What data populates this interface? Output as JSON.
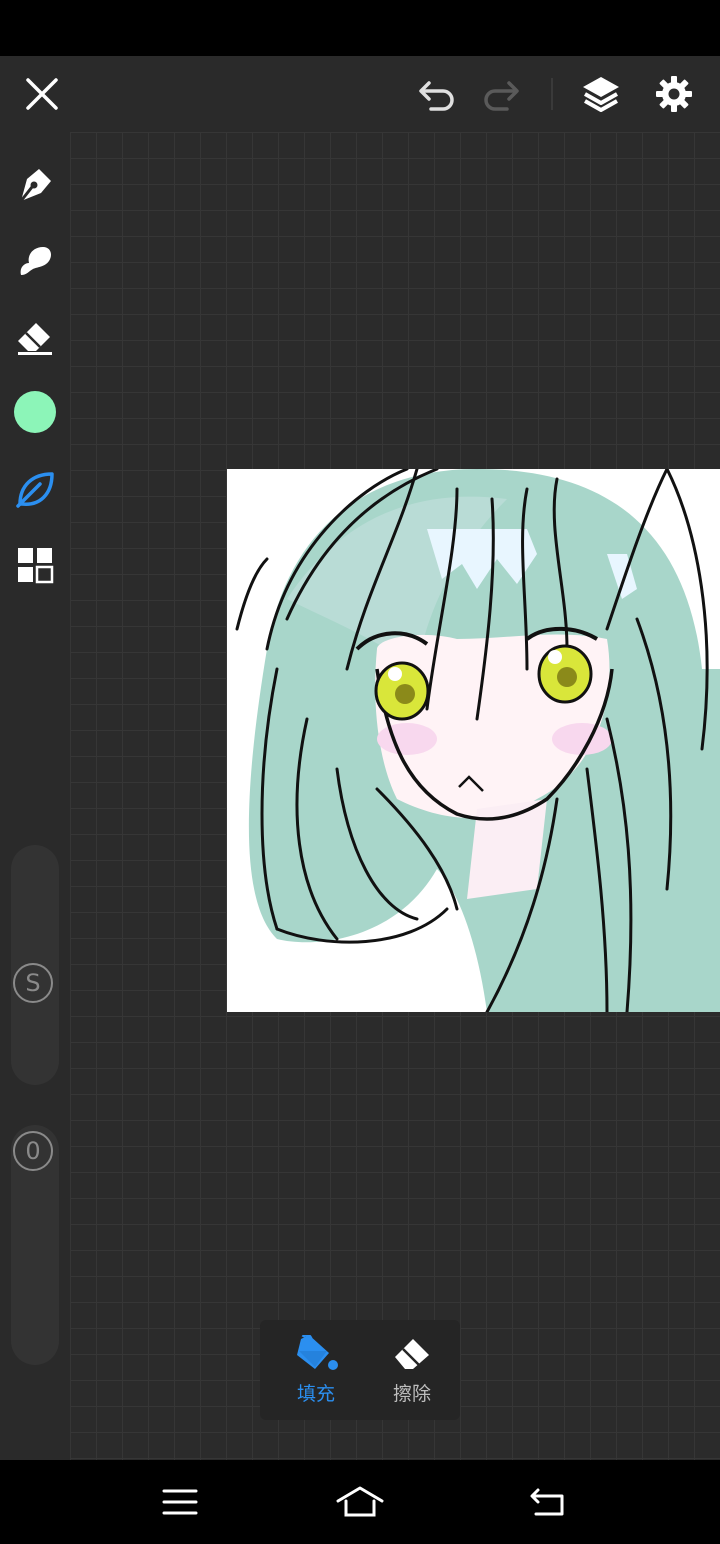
{
  "app": {
    "accent": "#2b8ff0",
    "icon_color": "#ffffff",
    "icon_disabled": "#5a5a5a"
  },
  "top_bar": {
    "close_icon": "close-icon",
    "undo_icon": "undo-icon",
    "redo_icon": "redo-icon",
    "layers_icon": "layers-icon",
    "settings_icon": "gear-icon"
  },
  "left_toolbar": {
    "tools": [
      {
        "name": "pen-tool",
        "icon": "pen-nib-icon"
      },
      {
        "name": "smudge-tool",
        "icon": "smudge-icon"
      },
      {
        "name": "eraser-tool",
        "icon": "eraser-icon"
      },
      {
        "name": "color-picker",
        "icon": "color-swatch",
        "color": "#8cf5b8"
      },
      {
        "name": "fill-tool",
        "icon": "leaf-icon",
        "active": true
      },
      {
        "name": "grid-tool",
        "icon": "grid-icon"
      }
    ],
    "size_slider_label": "S",
    "opacity_slider_label": "0"
  },
  "fill_popup": {
    "fill_label": "填充",
    "erase_label": "擦除"
  },
  "nav_bar": {
    "menu_icon": "menu-icon",
    "home_icon": "home-icon",
    "back_icon": "back-icon"
  }
}
